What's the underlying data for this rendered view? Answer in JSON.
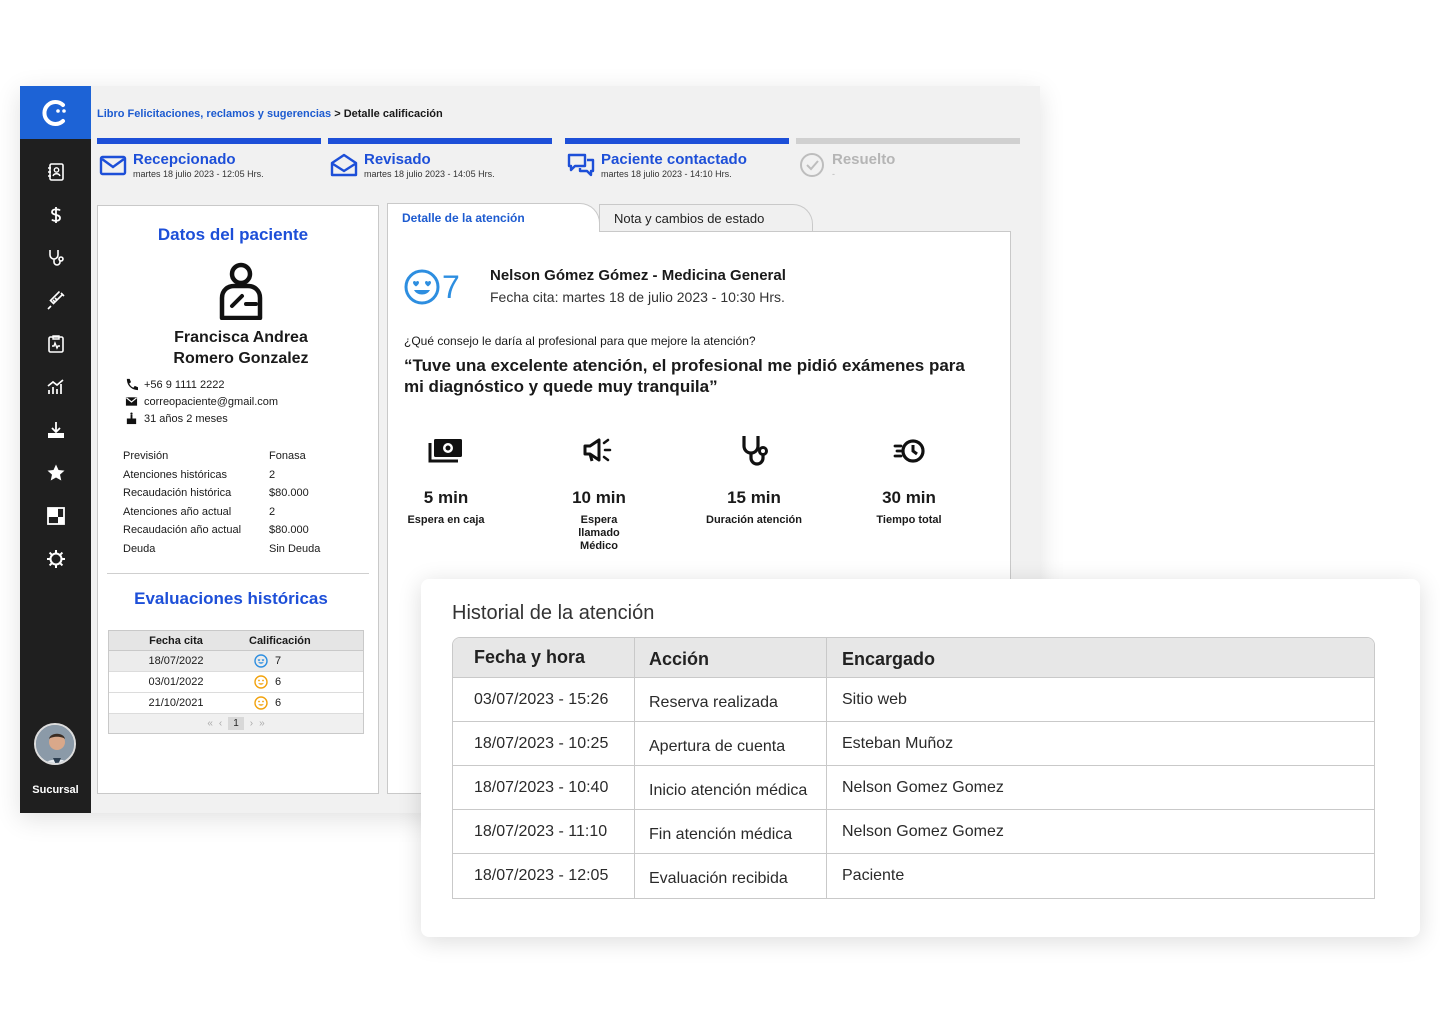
{
  "breadcrumb": {
    "link": "Libro Felicitaciones, reclamos y sugerencias",
    "separator": " > ",
    "current": "Detalle calificación"
  },
  "sidebar": {
    "icons": [
      "contacts-icon",
      "dollar-icon",
      "stethoscope-icon",
      "syringe-icon",
      "medical-file-icon",
      "analytics-icon",
      "download-icon",
      "star-icon",
      "dashboard-icon",
      "settings-icon"
    ],
    "user_label": "Sucursal"
  },
  "steps": [
    {
      "title": "Recepcionado",
      "date": "martes 18 julio 2023 - 12:05 Hrs.",
      "icon": "mail-icon",
      "active": true
    },
    {
      "title": "Revisado",
      "date": "martes 18 julio 2023 - 14:05 Hrs.",
      "icon": "open-mail-icon",
      "active": true
    },
    {
      "title": "Paciente contactado",
      "date": "martes 18 julio 2023 - 14:10 Hrs.",
      "icon": "chat-icon",
      "active": true
    },
    {
      "title": "Resuelto",
      "date": "-",
      "icon": "check-circle-icon",
      "active": false
    }
  ],
  "patient": {
    "title": "Datos del paciente",
    "name_line1": "Francisca Andrea",
    "name_line2": "Romero Gonzalez",
    "phone": "+56 9 1111 2222",
    "email": "correopaciente@gmail.com",
    "age": "31 años 2 meses",
    "info": [
      {
        "label": "Previsión",
        "value": "Fonasa"
      },
      {
        "label": "Atenciones históricas",
        "value": "2"
      },
      {
        "label": "Recaudación histórica",
        "value": "$80.000"
      },
      {
        "label": "Atenciones año actual",
        "value": "2"
      },
      {
        "label": "Recaudación año actual",
        "value": "$80.000"
      },
      {
        "label": "Deuda",
        "value": "Sin Deuda"
      }
    ]
  },
  "evaluations": {
    "title": "Evaluaciones históricas",
    "headers": [
      "Fecha cita",
      "Calificación"
    ],
    "rows": [
      {
        "date": "18/07/2022",
        "score": "7",
        "face": "love",
        "color": "#2d8ee0"
      },
      {
        "date": "03/01/2022",
        "score": "6",
        "face": "happy",
        "color": "#f2a20c"
      },
      {
        "date": "21/10/2021",
        "score": "6",
        "face": "happy",
        "color": "#f2a20c"
      }
    ],
    "pager": {
      "first": "«",
      "prev": "‹",
      "page": "1",
      "next": "›",
      "last": "»"
    }
  },
  "tabs": {
    "detail": "Detalle de la atención",
    "notes": "Nota y cambios de estado"
  },
  "detail": {
    "score": "7",
    "doctor": "Nelson Gómez Gómez - Medicina General",
    "appointment": "Fecha cita: martes 18 de julio 2023 - 10:30 Hrs.",
    "question": "¿Qué consejo le daría al profesional para que mejore la atención?",
    "quote_line1": "“Tuve una excelente atención, el profesional me pidió exámenes para",
    "quote_line2": "mi diagnóstico y quede muy tranquila”",
    "metrics": [
      {
        "value": "5 min",
        "label": "Espera en caja",
        "icon": "cash-icon"
      },
      {
        "value": "10 min",
        "label": "Espera llamado Médico",
        "icon": "megaphone-icon"
      },
      {
        "value": "15 min",
        "label": "Duración atención",
        "icon": "stethoscope-icon"
      },
      {
        "value": "30 min",
        "label": "Tiempo total",
        "icon": "fast-clock-icon"
      }
    ]
  },
  "history": {
    "title": "Historial de la atención",
    "headers": [
      "Fecha y hora",
      "Acción",
      "Encargado"
    ],
    "rows": [
      {
        "datetime": "03/07/2023 - 15:26",
        "action": "Reserva realizada",
        "owner": "Sitio web"
      },
      {
        "datetime": "18/07/2023 - 10:25",
        "action": "Apertura de cuenta",
        "owner": "Esteban Muñoz"
      },
      {
        "datetime": "18/07/2023 - 10:40",
        "action": "Inicio atención médica",
        "owner": "Nelson Gomez Gomez"
      },
      {
        "datetime": "18/07/2023 - 11:10",
        "action": "Fin atención médica",
        "owner": "Nelson Gomez Gomez"
      },
      {
        "datetime": "18/07/2023 - 12:05",
        "action": "Evaluación recibida",
        "owner": "Paciente"
      }
    ]
  },
  "colors": {
    "brand": "#1d4fd8",
    "link": "#1d5bd0",
    "sidebar": "#1f1f1f",
    "score_blue": "#2d8ee0",
    "score_orange": "#f2a20c"
  }
}
